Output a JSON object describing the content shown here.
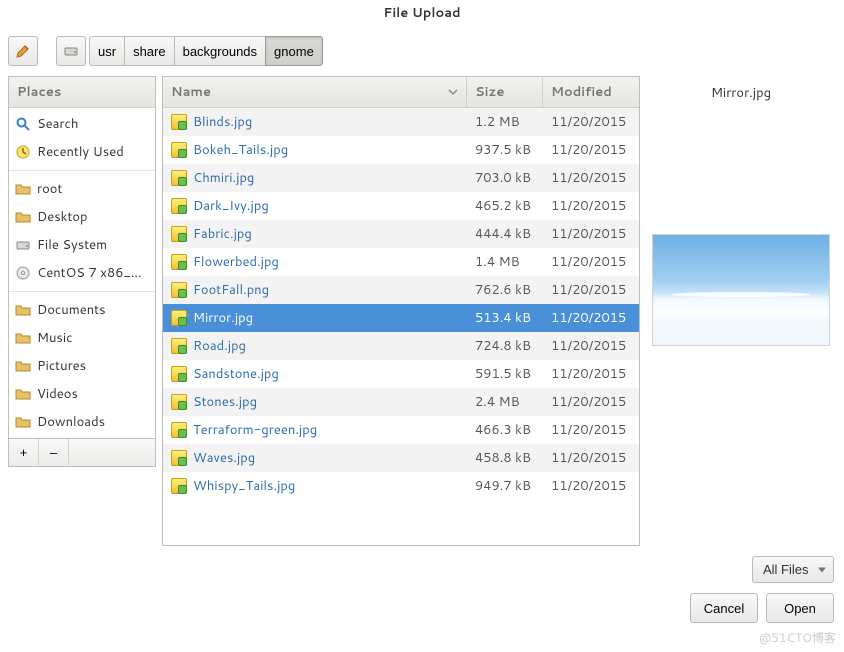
{
  "title": "File Upload",
  "toolbar": {
    "edit_tip": "Type a file name",
    "home_tip": "Home"
  },
  "breadcrumbs": [
    "usr",
    "share",
    "backgrounds",
    "gnome"
  ],
  "breadcrumb_active_index": 3,
  "places_header": "Places",
  "places": [
    {
      "icon": "search-icon",
      "label": "Search"
    },
    {
      "icon": "recent-icon",
      "label": "Recently Used"
    },
    {
      "sep": true
    },
    {
      "icon": "folder-icon",
      "label": "root"
    },
    {
      "icon": "folder-icon",
      "label": "Desktop"
    },
    {
      "icon": "drive-icon",
      "label": "File System"
    },
    {
      "icon": "disc-icon",
      "label": "CentOS 7 x86_..."
    },
    {
      "sep": true
    },
    {
      "icon": "folder-icon",
      "label": "Documents"
    },
    {
      "icon": "folder-icon",
      "label": "Music"
    },
    {
      "icon": "folder-icon",
      "label": "Pictures"
    },
    {
      "icon": "folder-icon",
      "label": "Videos"
    },
    {
      "icon": "folder-icon",
      "label": "Downloads"
    }
  ],
  "side_actions": {
    "add": "+",
    "remove": "–"
  },
  "columns": {
    "name": "Name",
    "size": "Size",
    "modified": "Modified"
  },
  "sort_indicator_column": "name",
  "files": [
    {
      "name": "Blinds.jpg",
      "size": "1.2 MB",
      "modified": "11/20/2015"
    },
    {
      "name": "Bokeh_Tails.jpg",
      "size": "937.5 kB",
      "modified": "11/20/2015"
    },
    {
      "name": "Chmiri.jpg",
      "size": "703.0 kB",
      "modified": "11/20/2015"
    },
    {
      "name": "Dark_Ivy.jpg",
      "size": "465.2 kB",
      "modified": "11/20/2015"
    },
    {
      "name": "Fabric.jpg",
      "size": "444.4 kB",
      "modified": "11/20/2015"
    },
    {
      "name": "Flowerbed.jpg",
      "size": "1.4 MB",
      "modified": "11/20/2015"
    },
    {
      "name": "FootFall.png",
      "size": "762.6 kB",
      "modified": "11/20/2015"
    },
    {
      "name": "Mirror.jpg",
      "size": "513.4 kB",
      "modified": "11/20/2015",
      "selected": true
    },
    {
      "name": "Road.jpg",
      "size": "724.8 kB",
      "modified": "11/20/2015"
    },
    {
      "name": "Sandstone.jpg",
      "size": "591.5 kB",
      "modified": "11/20/2015"
    },
    {
      "name": "Stones.jpg",
      "size": "2.4 MB",
      "modified": "11/20/2015"
    },
    {
      "name": "Terraform-green.jpg",
      "size": "466.3 kB",
      "modified": "11/20/2015"
    },
    {
      "name": "Waves.jpg",
      "size": "458.8 kB",
      "modified": "11/20/2015"
    },
    {
      "name": "Whispy_Tails.jpg",
      "size": "949.7 kB",
      "modified": "11/20/2015"
    }
  ],
  "preview_name": "Mirror.jpg",
  "filter": {
    "selected": "All Files",
    "options": [
      "All Files"
    ]
  },
  "buttons": {
    "cancel": "Cancel",
    "open": "Open"
  },
  "watermark": "@51CTO博客"
}
